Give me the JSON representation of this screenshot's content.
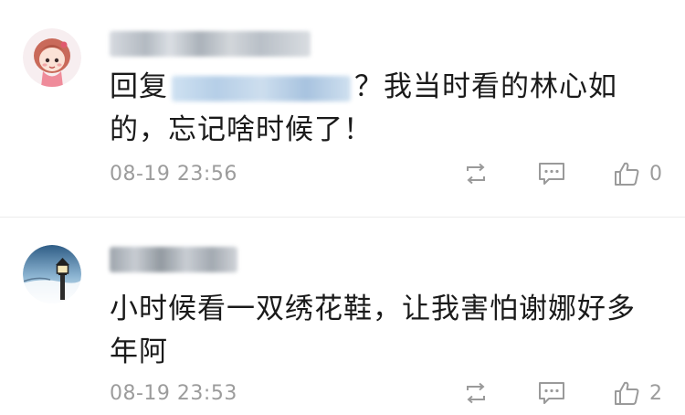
{
  "comments": [
    {
      "text": "回复",
      "text_suffix": "？我当时看的林心如的，忘记啥时候了！",
      "timestamp": "08-19 23:56",
      "like_count": "0",
      "avatar_icon": "cartoon-girl-avatar",
      "colors": {
        "mention": "#7ba6d4",
        "meta": "#9c9c9c"
      }
    },
    {
      "text": "小时候看一双绣花鞋，让我害怕谢娜好多年阿",
      "timestamp": "08-19 23:53",
      "like_count": "2",
      "avatar_icon": "lighthouse-lamp-avatar"
    }
  ],
  "icons": {
    "repost": "repost-icon",
    "reply": "comment-icon",
    "like": "thumbs-up-icon"
  }
}
